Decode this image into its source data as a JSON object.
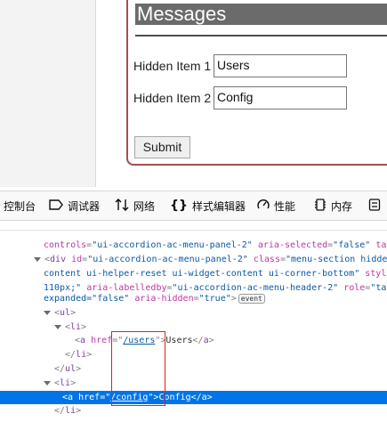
{
  "form": {
    "title": "Messages",
    "fields": [
      {
        "label": "Hidden Item 1",
        "value": "Users"
      },
      {
        "label": "Hidden Item 2",
        "value": "Config"
      }
    ],
    "submit_label": "Submit"
  },
  "devtools": {
    "tabs": [
      {
        "icon": "console-icon",
        "label": "控制台"
      },
      {
        "icon": "debugger-icon",
        "label": "调试器"
      },
      {
        "icon": "network-icon",
        "label": "网络"
      },
      {
        "icon": "style-editor-icon",
        "label": "样式编辑器"
      },
      {
        "icon": "performance-icon",
        "label": "性能"
      },
      {
        "icon": "memory-icon",
        "label": "内存"
      }
    ],
    "markup": {
      "line1": {
        "attr1": "controls",
        "val1": "\"ui-accordion-ac-menu-panel-2\"",
        "attr2": "aria-selected",
        "val2": "\"false\"",
        "rest": "tab"
      },
      "line2": {
        "tag": "div",
        "id_attr": "id",
        "id_val": "\"ui-accordion-ac-menu-panel-2\"",
        "class_attr": "class",
        "class_val": "\"menu-section hidden"
      },
      "line3": {
        "text": "content ui-helper-reset ui-widget-content ui-corner-bottom\"",
        "attr": "style"
      },
      "line4": {
        "text1": "110px;\"",
        "attr1": "aria-labelledby",
        "val1": "\"ui-accordion-ac-menu-header-2\"",
        "attr2": "role",
        "val2": "\"tab"
      },
      "line5": {
        "text1": "expanded=\"false\"",
        "attr": "aria-hidden",
        "val": "\"true\"",
        "badge": "event"
      },
      "ul_tag": "ul",
      "li_tag": "li",
      "a_tag": "a",
      "href_attr": "href",
      "link1": {
        "href": "/users",
        "text": "Users"
      },
      "link2": {
        "href": "/config",
        "text": "Config"
      }
    }
  }
}
